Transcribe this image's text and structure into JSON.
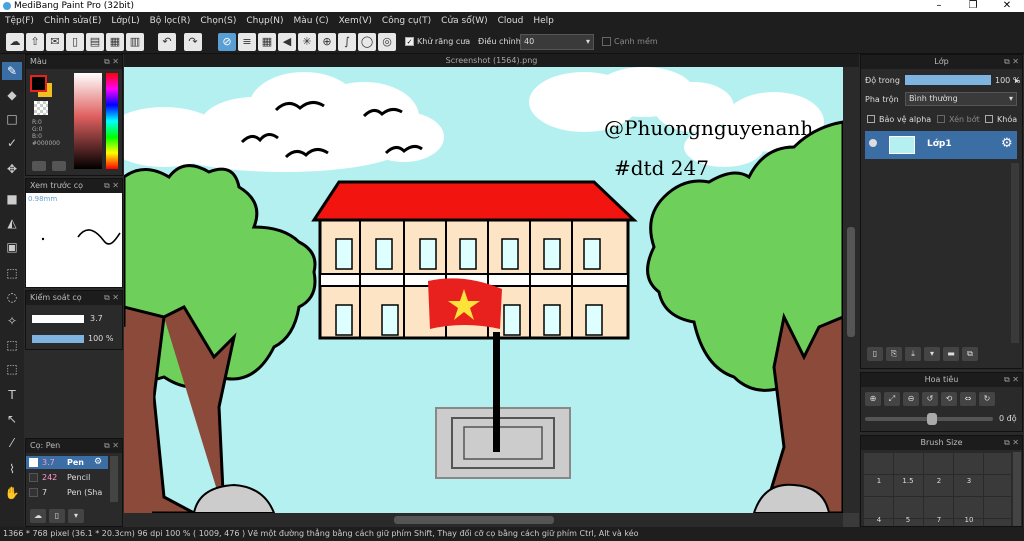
{
  "window": {
    "title": "MediBang Paint Pro (32bit)"
  },
  "menu": [
    "Tệp(F)",
    "Chỉnh sửa(E)",
    "Lớp(L)",
    "Bộ lọc(R)",
    "Chọn(S)",
    "Chụp(N)",
    "Màu (C)",
    "Xem(V)",
    "Công cụ(T)",
    "Cửa sổ(W)",
    "Cloud",
    "Help"
  ],
  "toolbar": {
    "antialias_label": "Khử răng cưa",
    "adjust_label": "Điều chỉnh",
    "adjust_value": "40",
    "smooth_label": "Cạnh mềm"
  },
  "color_panel": {
    "title": "Màu",
    "r": "R:0",
    "g": "G:0",
    "b": "B:0",
    "hex": "#000000"
  },
  "brush_preview": {
    "title": "Xem trước cọ",
    "size": "0.98mm"
  },
  "brush_control": {
    "title": "Kiểm soát cọ",
    "size": "3.7",
    "opacity": "100 %"
  },
  "brush_list": {
    "title": "Cọ: Pen",
    "items": [
      {
        "size": "3.7",
        "name": "Pen"
      },
      {
        "size": "242",
        "name": "Pencil"
      },
      {
        "size": "7",
        "name": "Pen (Sha"
      }
    ]
  },
  "document": {
    "filename": "Screenshot (1564).png"
  },
  "drawing": {
    "handle": "@Phuongnguyenanh",
    "tag": "#dtd 247"
  },
  "layer_panel": {
    "title": "Lớp",
    "opacity_label": "Độ trong",
    "opacity_value": "100 %",
    "blend_label": "Pha trộn",
    "blend_value": "Bình thường",
    "alpha_label": "Bảo vệ alpha",
    "clip_label": "Xén bớt",
    "lock_label": "Khóa",
    "layer_name": "Lớp1"
  },
  "navigator": {
    "title": "Hoa tiêu",
    "angle": "0 độ"
  },
  "brush_size": {
    "title": "Brush Size",
    "sizes": [
      "1",
      "1.5",
      "2",
      "3",
      "4",
      "5",
      "7",
      "10"
    ]
  },
  "status": {
    "text": "1366 * 768 pixel  (36.1 * 20.3cm)  96 dpi  100 %  ( 1009, 476 )  Vẽ một đường thẳng bằng cách giữ phím Shift, Thay đổi cỡ cọ bằng cách giữ phím Ctrl, Alt và kéo"
  },
  "colors": {
    "flag_red": "#e8201e",
    "roof_red": "#f2150f",
    "sky": "#b5f0f0",
    "tree": "#6ecf5a",
    "trunk": "#8b4a3a",
    "accent": "#5a9fd4"
  }
}
